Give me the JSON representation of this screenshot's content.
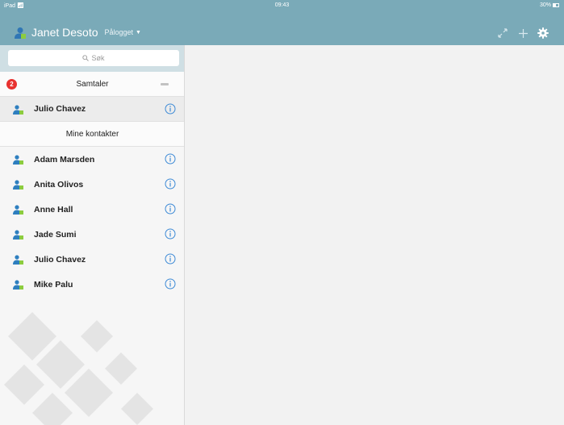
{
  "status_bar": {
    "device": "iPad",
    "time": "09:43",
    "battery": "30%"
  },
  "header": {
    "user_name": "Janet Desoto",
    "presence": "Pålogget",
    "icons": [
      "expand-icon",
      "add-icon",
      "gear-icon"
    ]
  },
  "search": {
    "placeholder": "Søk"
  },
  "conversations": {
    "badge_count": "2",
    "title": "Samtaler",
    "items": [
      {
        "name": "Julio Chavez"
      }
    ]
  },
  "contacts": {
    "title": "Mine kontakter",
    "items": [
      {
        "name": "Adam Marsden"
      },
      {
        "name": "Anita Olivos"
      },
      {
        "name": "Anne Hall"
      },
      {
        "name": "Jade Sumi"
      },
      {
        "name": "Julio Chavez"
      },
      {
        "name": "Mike Palu"
      }
    ]
  },
  "colors": {
    "header_bg": "#7aaab8",
    "badge": "#e8312f",
    "info": "#3d8ad6",
    "person": "#2e7fbf"
  }
}
